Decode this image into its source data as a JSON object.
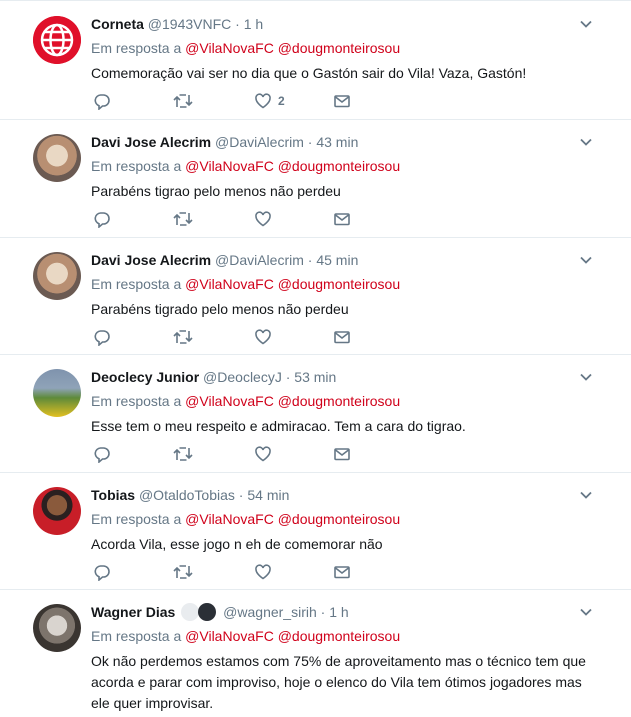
{
  "reply_prefix": "Em resposta a",
  "colors": {
    "mention": "#d0021b",
    "muted": "#657786",
    "text": "#14171a",
    "divider": "#e6ecf0"
  },
  "tweets": [
    {
      "name": "Corneta",
      "handle": "@1943VNFC",
      "dot": "·",
      "time": "1 h",
      "mentions": [
        "@VilaNovaFC",
        "@dougmonteirosou"
      ],
      "text": "Comemoração vai ser no dia que o Gastón sair do Vila! Vaza, Gastón!",
      "like_count": "2",
      "avatar": "globe-logo"
    },
    {
      "name": "Davi Jose Alecrim",
      "handle": "@DaviAlecrim",
      "dot": "·",
      "time": "43 min",
      "mentions": [
        "@VilaNovaFC",
        "@dougmonteirosou"
      ],
      "text": "Parabéns tigrao pelo menos não perdeu",
      "like_count": "",
      "avatar": "photo"
    },
    {
      "name": "Davi Jose Alecrim",
      "handle": "@DaviAlecrim",
      "dot": "·",
      "time": "45 min",
      "mentions": [
        "@VilaNovaFC",
        "@dougmonteirosou"
      ],
      "text": "Parabéns tigrado pelo menos não perdeu",
      "like_count": "",
      "avatar": "photo"
    },
    {
      "name": "Deoclecy Junior",
      "handle": "@DeoclecyJ",
      "dot": "·",
      "time": "53 min",
      "mentions": [
        "@VilaNovaFC",
        "@dougmonteirosou"
      ],
      "text": "Esse tem o meu respeito e admiracao. Tem a cara do tigrao.",
      "like_count": "",
      "avatar": "photo"
    },
    {
      "name": "Tobias",
      "handle": "@OtaldoTobias",
      "dot": "·",
      "time": "54 min",
      "mentions": [
        "@VilaNovaFC",
        "@dougmonteirosou"
      ],
      "text": "Acorda Vila, esse jogo n eh de comemorar não",
      "like_count": "",
      "avatar": "photo"
    },
    {
      "name": "Wagner Dias",
      "handle": "@wagner_sirih",
      "dot": "·",
      "time": "1 h",
      "mentions": [
        "@VilaNovaFC",
        "@dougmonteirosou"
      ],
      "text": "Ok não perdemos estamos com 75% de aproveitamento mas o técnico tem que acorda e parar com improviso, hoje o elenco do Vila tem ótimos jogadores mas ele quer improvisar.",
      "like_count": "",
      "avatar": "photo"
    }
  ]
}
